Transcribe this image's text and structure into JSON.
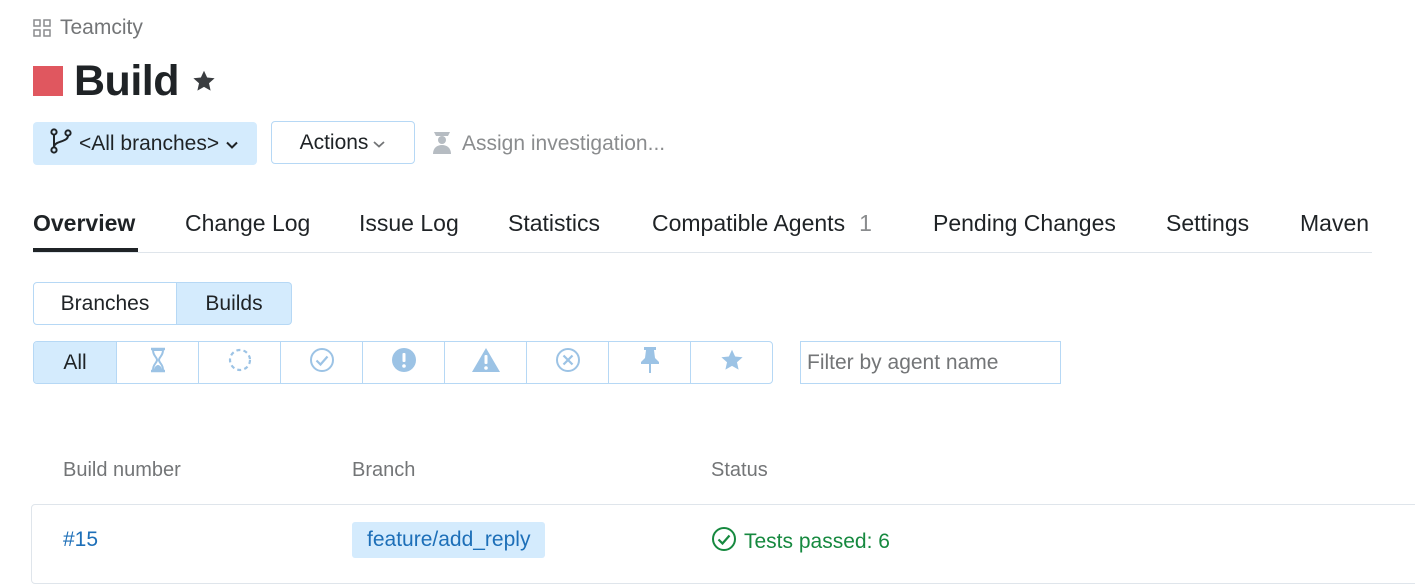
{
  "breadcrumb": {
    "project": "Teamcity",
    "icon": "grid-icon"
  },
  "header": {
    "title": "Build",
    "status_color": "#e0575f",
    "star_icon": "star-icon"
  },
  "toolbar": {
    "branch_selector": "<All branches>",
    "actions_label": "Actions",
    "assign_label": "Assign investigation..."
  },
  "tabs": [
    {
      "label": "Overview",
      "active": true
    },
    {
      "label": "Change Log"
    },
    {
      "label": "Issue Log"
    },
    {
      "label": "Statistics"
    },
    {
      "label": "Compatible Agents",
      "count": "1"
    },
    {
      "label": "Pending Changes"
    },
    {
      "label": "Settings"
    },
    {
      "label": "Maven"
    }
  ],
  "view_toggle": {
    "branches": "Branches",
    "builds": "Builds",
    "selected": "Builds"
  },
  "filters": {
    "all_label": "All",
    "buttons": [
      "hourglass-icon",
      "spinner-icon",
      "check-circle-icon",
      "exclamation-circle-icon",
      "warning-icon",
      "x-circle-icon",
      "pin-icon",
      "star-icon"
    ]
  },
  "agent_filter": {
    "placeholder": "Filter by agent name",
    "value": ""
  },
  "table": {
    "columns": [
      "Build number",
      "Branch",
      "Status"
    ],
    "rows": [
      {
        "number": "#15",
        "branch": "feature/add_reply",
        "status": "Tests passed: 6"
      }
    ]
  },
  "colors": {
    "accent_bg": "#d4ebfd",
    "border": "#b6d8f5",
    "link": "#1d6fb8",
    "success": "#16893f",
    "failed": "#e0575f"
  }
}
